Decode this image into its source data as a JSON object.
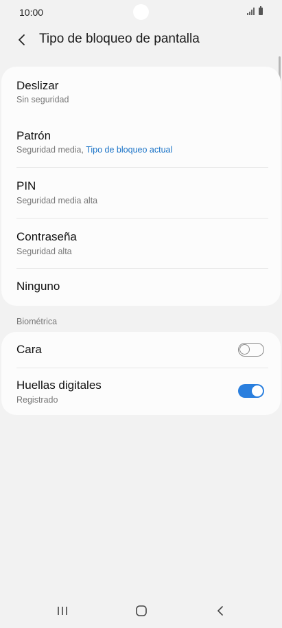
{
  "status_bar": {
    "time": "10:00"
  },
  "header": {
    "title": "Tipo de bloqueo de pantalla"
  },
  "lock_types": [
    {
      "title": "Deslizar",
      "subtitle": "Sin seguridad"
    },
    {
      "title": "Patrón",
      "subtitle": "Seguridad media, ",
      "subtitle_accent": "Tipo de bloqueo actual"
    },
    {
      "title": "PIN",
      "subtitle": "Seguridad media alta"
    },
    {
      "title": "Contraseña",
      "subtitle": "Seguridad alta"
    },
    {
      "title": "Ninguno"
    }
  ],
  "biometrics": {
    "section_label": "Biométrica",
    "items": [
      {
        "title": "Cara",
        "enabled": false
      },
      {
        "title": "Huellas digitales",
        "subtitle": "Registrado",
        "enabled": true
      }
    ]
  },
  "colors": {
    "accent": "#1a73c7",
    "toggle_on": "#2a7fde",
    "background": "#f2f2f2",
    "card": "#fcfcfc"
  },
  "icons": {
    "back": "chevron-left-icon",
    "recents": "recents-icon",
    "home": "home-icon",
    "nav_back": "back-icon"
  }
}
